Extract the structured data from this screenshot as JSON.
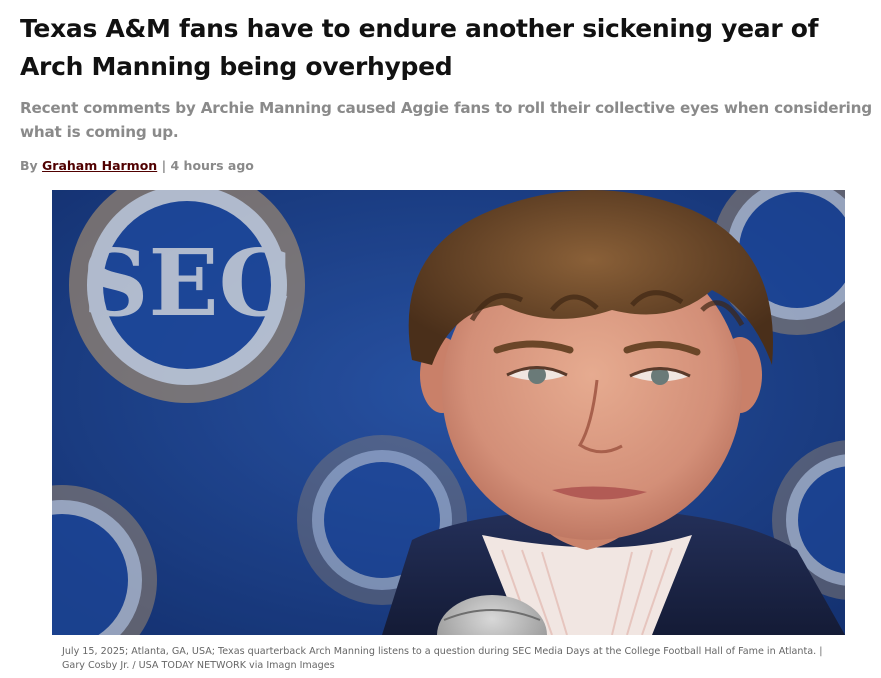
{
  "article": {
    "headline": "Texas A&M fans have to endure another sickening year of Arch Manning being overhyped",
    "subheadline": "Recent comments by Archie Manning caused Aggie fans to roll their collective eyes when considering what is coming up.",
    "byline": {
      "prefix": "By",
      "author": "Graham Harmon",
      "separator": "|",
      "timestamp": "4 hours ago"
    },
    "image": {
      "backdrop_logo_text": "SEC",
      "subject": "Arch Manning at SEC Media Days podium",
      "colors": {
        "backdrop_blue": "#1b3f86",
        "logo_white": "#f2f2ee",
        "logo_ring": "#c9a36a",
        "jacket_navy": "#1a2447",
        "hair_brown": "#6b4628",
        "skin": "#d99a82"
      }
    },
    "caption": "July 15, 2025; Atlanta, GA, USA; Texas quarterback Arch Manning listens to a question during SEC Media Days at the College Football Hall of Fame in Atlanta. | Gary Cosby Jr. / USA TODAY NETWORK via Imagn Images"
  },
  "theme": {
    "author_link_color": "#500000",
    "muted_text_color": "#8a8a8a"
  }
}
